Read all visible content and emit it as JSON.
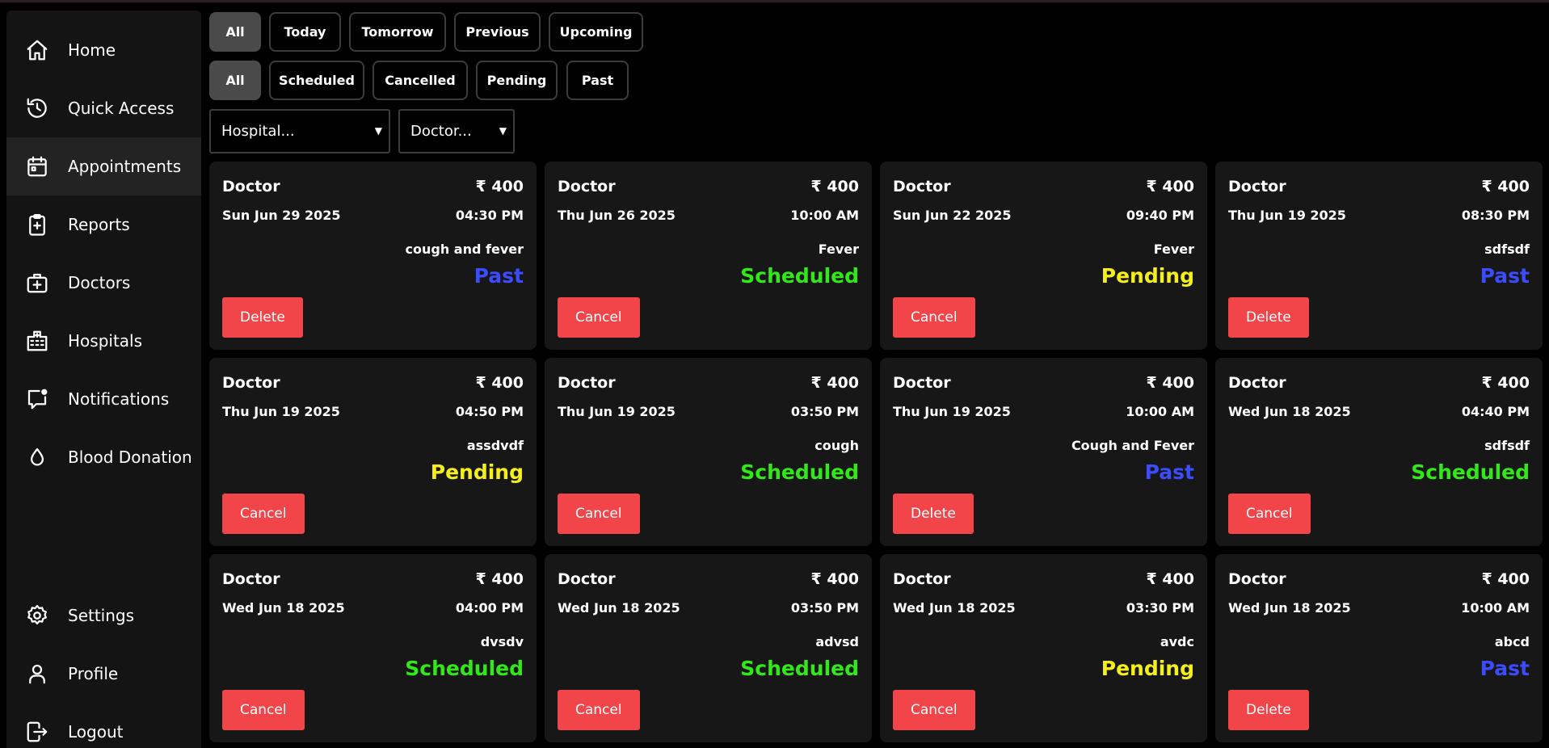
{
  "sidebar": {
    "items": [
      {
        "label": "Home",
        "icon": "home-icon"
      },
      {
        "label": "Quick Access",
        "icon": "history-icon"
      },
      {
        "label": "Appointments",
        "icon": "calendar-icon"
      },
      {
        "label": "Reports",
        "icon": "clipboard-plus-icon"
      },
      {
        "label": "Doctors",
        "icon": "medical-kit-icon"
      },
      {
        "label": "Hospitals",
        "icon": "hospital-icon"
      },
      {
        "label": "Notifications",
        "icon": "message-notification-icon"
      },
      {
        "label": "Blood Donation",
        "icon": "drop-icon"
      }
    ],
    "bottom_items": [
      {
        "label": "Settings",
        "icon": "gear-icon"
      },
      {
        "label": "Profile",
        "icon": "user-icon"
      },
      {
        "label": "Logout",
        "icon": "logout-icon"
      }
    ],
    "active": "Appointments"
  },
  "filters": {
    "time": [
      "All",
      "Today",
      "Tomorrow",
      "Previous",
      "Upcoming"
    ],
    "time_selected": "All",
    "status": [
      "All",
      "Scheduled",
      "Cancelled",
      "Pending",
      "Past"
    ],
    "status_selected": "All",
    "hospital_select": "Hospital...",
    "doctor_select": "Doctor..."
  },
  "colors": {
    "accent_button": "#f2454a",
    "status_past": "#3b4cff",
    "status_scheduled": "#33e81a",
    "status_pending": "#f5f01c"
  },
  "appointments": [
    {
      "doctor": "Doctor",
      "fee": "₹ 400",
      "date": "Sun Jun 29 2025",
      "time": "04:30 PM",
      "reason": "cough and fever",
      "status": "Past",
      "action": "Delete"
    },
    {
      "doctor": "Doctor",
      "fee": "₹ 400",
      "date": "Thu Jun 26 2025",
      "time": "10:00 AM",
      "reason": "Fever",
      "status": "Scheduled",
      "action": "Cancel"
    },
    {
      "doctor": "Doctor",
      "fee": "₹ 400",
      "date": "Sun Jun 22 2025",
      "time": "09:40 PM",
      "reason": "Fever",
      "status": "Pending",
      "action": "Cancel"
    },
    {
      "doctor": "Doctor",
      "fee": "₹ 400",
      "date": "Thu Jun 19 2025",
      "time": "08:30 PM",
      "reason": "sdfsdf",
      "status": "Past",
      "action": "Delete"
    },
    {
      "doctor": "Doctor",
      "fee": "₹ 400",
      "date": "Thu Jun 19 2025",
      "time": "04:50 PM",
      "reason": "assdvdf",
      "status": "Pending",
      "action": "Cancel"
    },
    {
      "doctor": "Doctor",
      "fee": "₹ 400",
      "date": "Thu Jun 19 2025",
      "time": "03:50 PM",
      "reason": "cough",
      "status": "Scheduled",
      "action": "Cancel"
    },
    {
      "doctor": "Doctor",
      "fee": "₹ 400",
      "date": "Thu Jun 19 2025",
      "time": "10:00 AM",
      "reason": "Cough and Fever",
      "status": "Past",
      "action": "Delete"
    },
    {
      "doctor": "Doctor",
      "fee": "₹ 400",
      "date": "Wed Jun 18 2025",
      "time": "04:40 PM",
      "reason": "sdfsdf",
      "status": "Scheduled",
      "action": "Cancel"
    },
    {
      "doctor": "Doctor",
      "fee": "₹ 400",
      "date": "Wed Jun 18 2025",
      "time": "04:00 PM",
      "reason": "dvsdv",
      "status": "Scheduled",
      "action": "Cancel"
    },
    {
      "doctor": "Doctor",
      "fee": "₹ 400",
      "date": "Wed Jun 18 2025",
      "time": "03:50 PM",
      "reason": "advsd",
      "status": "Scheduled",
      "action": "Cancel"
    },
    {
      "doctor": "Doctor",
      "fee": "₹ 400",
      "date": "Wed Jun 18 2025",
      "time": "03:30 PM",
      "reason": "avdc",
      "status": "Pending",
      "action": "Cancel"
    },
    {
      "doctor": "Doctor",
      "fee": "₹ 400",
      "date": "Wed Jun 18 2025",
      "time": "10:00 AM",
      "reason": "abcd",
      "status": "Past",
      "action": "Delete"
    }
  ]
}
